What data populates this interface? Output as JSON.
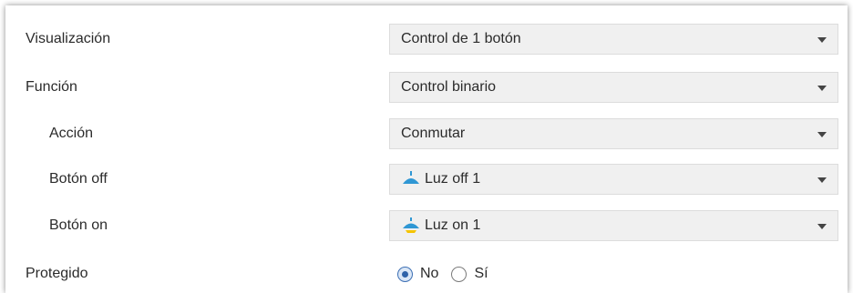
{
  "rows": [
    {
      "label": "Visualización",
      "value": "Control de 1 botón"
    },
    {
      "label": "Función",
      "value": "Control binario"
    },
    {
      "label": "Acción",
      "value": "Conmutar"
    },
    {
      "label": "Botón off",
      "value": "Luz off 1",
      "icon": "lamp-off-icon"
    },
    {
      "label": "Botón on",
      "value": "Luz on 1",
      "icon": "lamp-on-icon"
    }
  ],
  "protegido": {
    "label": "Protegido",
    "options": [
      {
        "label": "No",
        "selected": true
      },
      {
        "label": "Sí",
        "selected": false
      }
    ]
  },
  "colors": {
    "lamp_shade": "#2f97d4",
    "lamp_light": "#f5c400",
    "radio_selected": "#2f62a8"
  }
}
